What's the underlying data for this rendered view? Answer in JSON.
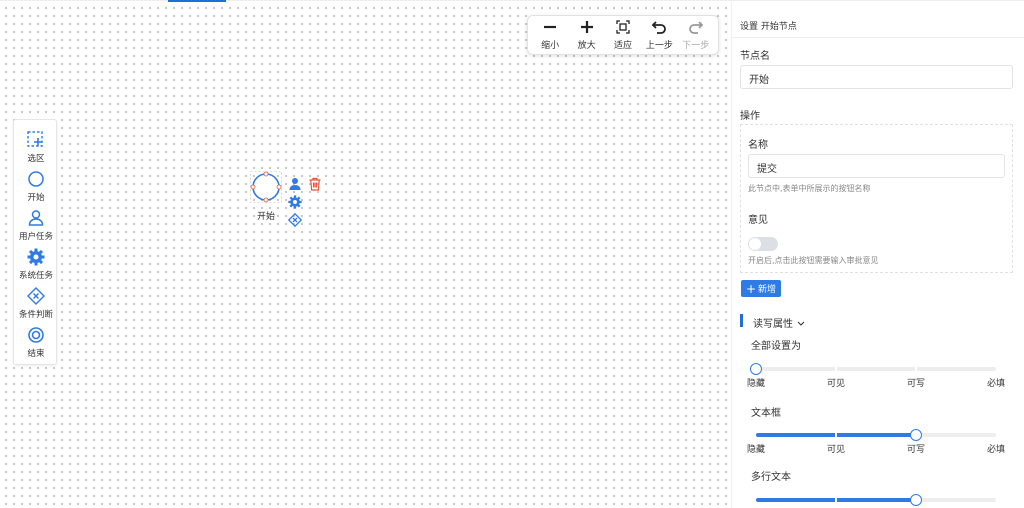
{
  "toolbar": {
    "zoom_out": "缩小",
    "zoom_in": "放大",
    "fit": "适应",
    "undo": "上一步",
    "redo": "下一步"
  },
  "palette": {
    "select": "选区",
    "start": "开始",
    "user_task": "用户任务",
    "system_task": "系统任务",
    "condition": "条件判断",
    "end": "结束"
  },
  "node": {
    "label": "开始"
  },
  "panel": {
    "title": "设置 开始节点",
    "node_name_label": "节点名",
    "node_name_value": "开始",
    "operations_label": "操作",
    "name_label": "名称",
    "name_value": "提交",
    "name_hint": "此节点中,表单中所展示的按钮名称",
    "opinion_label": "意见",
    "opinion_enabled": false,
    "opinion_hint": "开启后,点击此按钮需要输入审批意见",
    "add_button": "新增",
    "rw_section": "读写属性",
    "levels": [
      "隐藏",
      "可见",
      "可写",
      "必填"
    ],
    "fields": [
      {
        "label": "全部设置为",
        "level_index": 0
      },
      {
        "label": "文本框",
        "level_index": 2
      },
      {
        "label": "多行文本",
        "level_index": 2
      }
    ]
  },
  "colors": {
    "accent": "#2f7be6",
    "delete": "#e4553a"
  }
}
